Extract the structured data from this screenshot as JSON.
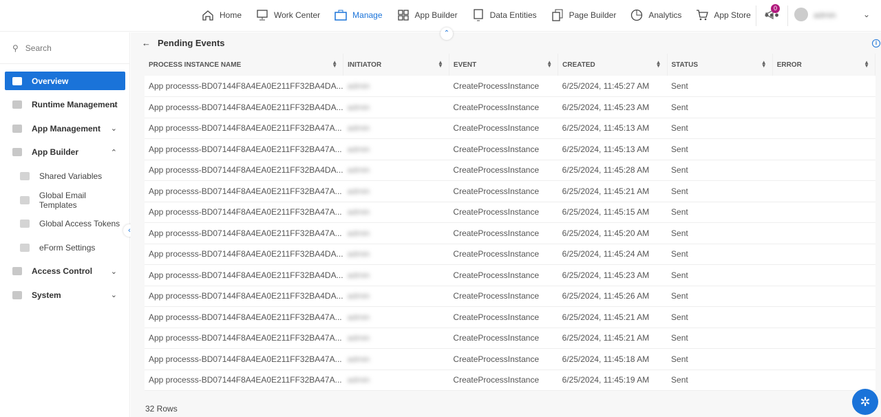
{
  "nav": {
    "items": [
      {
        "label": "Home",
        "icon": "home-icon"
      },
      {
        "label": "Work Center",
        "icon": "monitor-icon"
      },
      {
        "label": "Manage",
        "icon": "briefcase-icon",
        "active": true
      },
      {
        "label": "App Builder",
        "icon": "grid-icon"
      },
      {
        "label": "Data Entities",
        "icon": "screen-icon"
      },
      {
        "label": "Page Builder",
        "icon": "pages-icon"
      },
      {
        "label": "Analytics",
        "icon": "pie-icon"
      },
      {
        "label": "App Store",
        "icon": "cart-icon"
      }
    ],
    "more": "•••",
    "notifications": "0",
    "user": "admin"
  },
  "sidebar": {
    "search_placeholder": "Search",
    "items": [
      {
        "label": "Overview",
        "active": true
      },
      {
        "label": "Runtime Management",
        "chevron": "down"
      },
      {
        "label": "App Management",
        "chevron": "down"
      },
      {
        "label": "App Builder",
        "chevron": "up"
      },
      {
        "label": "Shared Variables",
        "sub": true
      },
      {
        "label": "Global Email Templates",
        "sub": true
      },
      {
        "label": "Global Access Tokens",
        "sub": true
      },
      {
        "label": "eForm Settings",
        "sub": true
      },
      {
        "label": "Access Control",
        "chevron": "down"
      },
      {
        "label": "System",
        "chevron": "down"
      }
    ]
  },
  "page": {
    "title": "Pending Events",
    "row_count": "32 Rows"
  },
  "table": {
    "columns": [
      "PROCESS INSTANCE NAME",
      "INITIATOR",
      "EVENT",
      "CREATED",
      "STATUS",
      "ERROR"
    ],
    "rows": [
      [
        "App processs-BD07144F8A4EA0E211FF32BA4DA...",
        "admin",
        "CreateProcessInstance",
        "6/25/2024, 11:45:27 AM",
        "Sent",
        ""
      ],
      [
        "App processs-BD07144F8A4EA0E211FF32BA4DA...",
        "admin",
        "CreateProcessInstance",
        "6/25/2024, 11:45:23 AM",
        "Sent",
        ""
      ],
      [
        "App processs-BD07144F8A4EA0E211FF32BA47A...",
        "admin",
        "CreateProcessInstance",
        "6/25/2024, 11:45:13 AM",
        "Sent",
        ""
      ],
      [
        "App processs-BD07144F8A4EA0E211FF32BA47A...",
        "admin",
        "CreateProcessInstance",
        "6/25/2024, 11:45:13 AM",
        "Sent",
        ""
      ],
      [
        "App processs-BD07144F8A4EA0E211FF32BA4DA...",
        "admin",
        "CreateProcessInstance",
        "6/25/2024, 11:45:28 AM",
        "Sent",
        ""
      ],
      [
        "App processs-BD07144F8A4EA0E211FF32BA47A...",
        "admin",
        "CreateProcessInstance",
        "6/25/2024, 11:45:21 AM",
        "Sent",
        ""
      ],
      [
        "App processs-BD07144F8A4EA0E211FF32BA47A...",
        "admin",
        "CreateProcessInstance",
        "6/25/2024, 11:45:15 AM",
        "Sent",
        ""
      ],
      [
        "App processs-BD07144F8A4EA0E211FF32BA47A...",
        "admin",
        "CreateProcessInstance",
        "6/25/2024, 11:45:20 AM",
        "Sent",
        ""
      ],
      [
        "App processs-BD07144F8A4EA0E211FF32BA4DA...",
        "admin",
        "CreateProcessInstance",
        "6/25/2024, 11:45:24 AM",
        "Sent",
        ""
      ],
      [
        "App processs-BD07144F8A4EA0E211FF32BA4DA...",
        "admin",
        "CreateProcessInstance",
        "6/25/2024, 11:45:23 AM",
        "Sent",
        ""
      ],
      [
        "App processs-BD07144F8A4EA0E211FF32BA4DA...",
        "admin",
        "CreateProcessInstance",
        "6/25/2024, 11:45:26 AM",
        "Sent",
        ""
      ],
      [
        "App processs-BD07144F8A4EA0E211FF32BA47A...",
        "admin",
        "CreateProcessInstance",
        "6/25/2024, 11:45:21 AM",
        "Sent",
        ""
      ],
      [
        "App processs-BD07144F8A4EA0E211FF32BA47A...",
        "admin",
        "CreateProcessInstance",
        "6/25/2024, 11:45:21 AM",
        "Sent",
        ""
      ],
      [
        "App processs-BD07144F8A4EA0E211FF32BA47A...",
        "admin",
        "CreateProcessInstance",
        "6/25/2024, 11:45:18 AM",
        "Sent",
        ""
      ],
      [
        "App processs-BD07144F8A4EA0E211FF32BA47A...",
        "admin",
        "CreateProcessInstance",
        "6/25/2024, 11:45:19 AM",
        "Sent",
        ""
      ]
    ]
  },
  "colors": {
    "accent": "#1a73d9",
    "badge": "#b0197d"
  }
}
